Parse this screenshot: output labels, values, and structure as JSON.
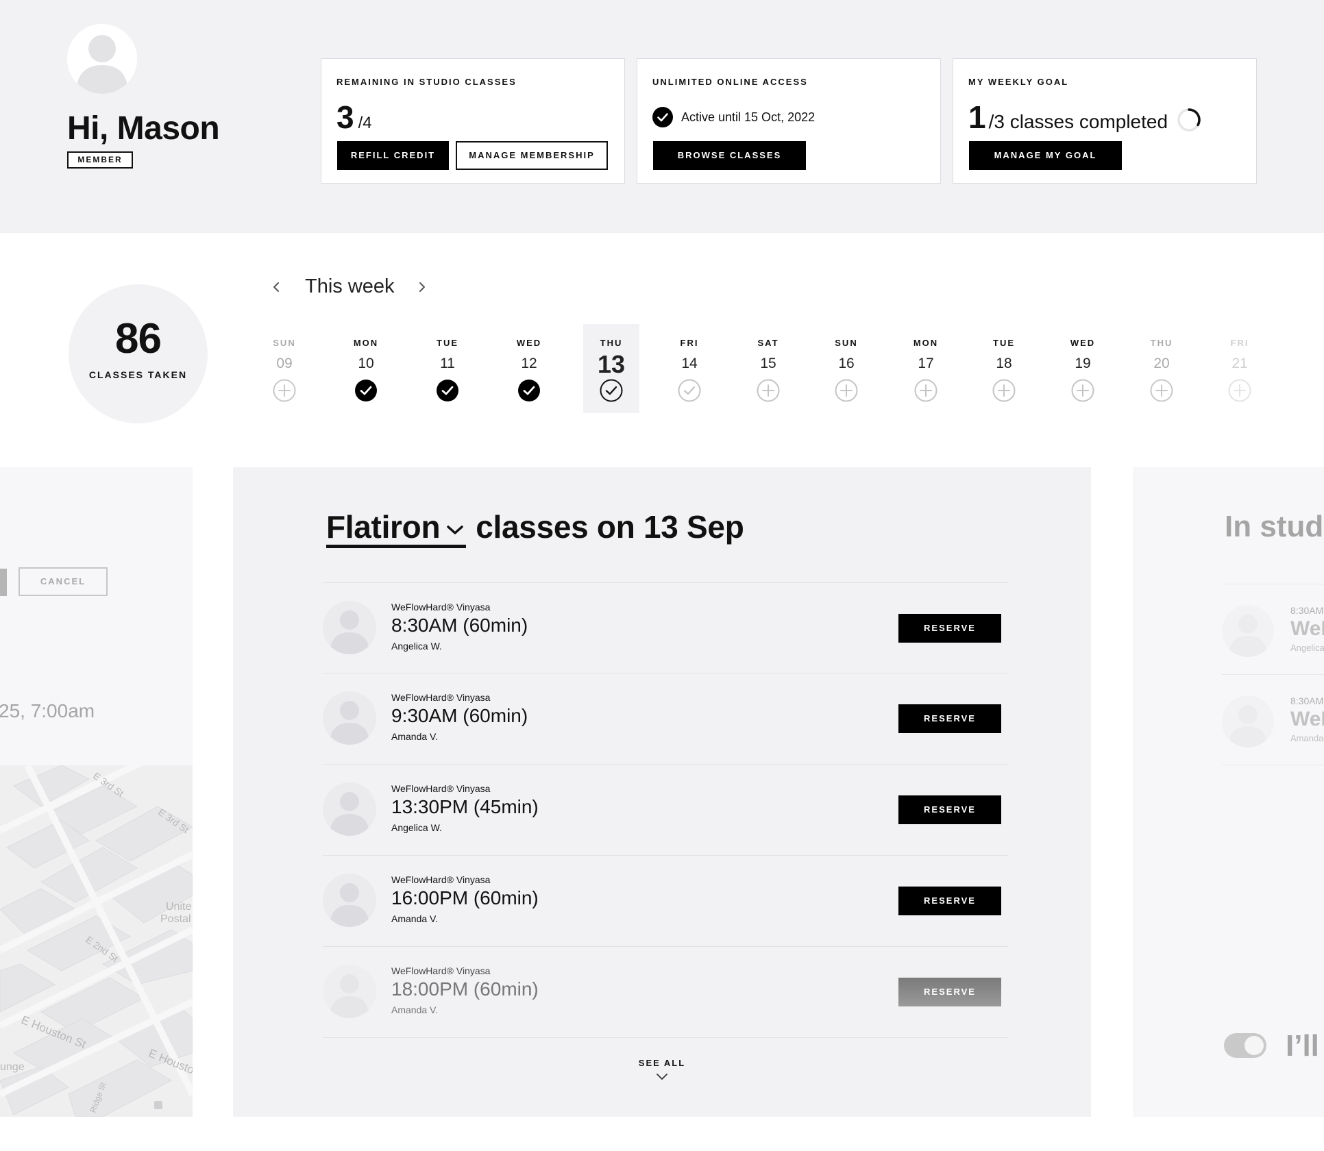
{
  "user": {
    "greeting": "Hi, Mason",
    "badge": "MEMBER"
  },
  "cards": {
    "studio": {
      "label": "REMAINING IN STUDIO CLASSES",
      "remaining": "3",
      "total": "/4",
      "refill_label": "REFILL CREDIT",
      "manage_label": "MANAGE MEMBERSHIP"
    },
    "online": {
      "label": "UNLIMITED ONLINE ACCESS",
      "status": "Active until 15 Oct, 2022",
      "browse_label": "BROWSE CLASSES"
    },
    "goal": {
      "label": "MY WEEKLY GOAL",
      "completed": "1",
      "rest": "/3 classes completed",
      "progress": 0.333,
      "manage_label": "MANAGE MY GOAL"
    }
  },
  "stats": {
    "classes_taken": "86",
    "classes_taken_label": "CLASSES TAKEN"
  },
  "week": {
    "title": "This week",
    "days": [
      {
        "dow": "SUN",
        "num": "09",
        "state": "add",
        "tone": "dim"
      },
      {
        "dow": "MON",
        "num": "10",
        "state": "done",
        "tone": "normal"
      },
      {
        "dow": "TUE",
        "num": "11",
        "state": "done",
        "tone": "normal"
      },
      {
        "dow": "WED",
        "num": "12",
        "state": "done",
        "tone": "normal"
      },
      {
        "dow": "THU",
        "num": "13",
        "state": "today",
        "tone": "active"
      },
      {
        "dow": "FRI",
        "num": "14",
        "state": "booked",
        "tone": "normal"
      },
      {
        "dow": "SAT",
        "num": "15",
        "state": "add",
        "tone": "normal"
      },
      {
        "dow": "SUN",
        "num": "16",
        "state": "add",
        "tone": "normal"
      },
      {
        "dow": "MON",
        "num": "17",
        "state": "add",
        "tone": "normal"
      },
      {
        "dow": "TUE",
        "num": "18",
        "state": "add",
        "tone": "normal"
      },
      {
        "dow": "WED",
        "num": "19",
        "state": "add",
        "tone": "normal"
      },
      {
        "dow": "THU",
        "num": "20",
        "state": "add",
        "tone": "dim"
      },
      {
        "dow": "FRI",
        "num": "21",
        "state": "add",
        "tone": "dimmer"
      }
    ]
  },
  "left_panel": {
    "cancel_label": "CANCEL",
    "date_text": "25, 7:00am",
    "map_labels": [
      "E 3rd St",
      "E 3rd St",
      "Unite",
      "Postal",
      "E 2nd St",
      "E Houston St",
      "E Housto",
      "unge",
      "Ridge St"
    ]
  },
  "main": {
    "location": "Flatiron",
    "heading_rest": "classes on 13 Sep",
    "reserve_label": "RESERVE",
    "see_all_label": "SEE ALL",
    "classes": [
      {
        "type": "WeFlowHard® Vinyasa",
        "time": "8:30AM (60min)",
        "instructor": "Angelica W."
      },
      {
        "type": "WeFlowHard® Vinyasa",
        "time": "9:30AM (60min)",
        "instructor": "Amanda V."
      },
      {
        "type": "WeFlowHard® Vinyasa",
        "time": "13:30PM (45min)",
        "instructor": "Angelica W."
      },
      {
        "type": "WeFlowHard® Vinyasa",
        "time": "16:00PM (60min)",
        "instructor": "Amanda V."
      },
      {
        "type": "WeFlowHard® Vinyasa",
        "time": "18:00PM (60min)",
        "instructor": "Amanda V."
      }
    ]
  },
  "right_panel": {
    "title": "In stud",
    "rows": [
      {
        "time": "8:30AM",
        "name": "WeF",
        "instructor": "Angelica"
      },
      {
        "time": "8:30AM",
        "name": "WeF",
        "instructor": "Amanda"
      }
    ],
    "optin_text": "I’ll"
  },
  "colors": {
    "page_bg": "#f2f2f4",
    "accent": "#000000",
    "muted": "#aaaaaa"
  }
}
